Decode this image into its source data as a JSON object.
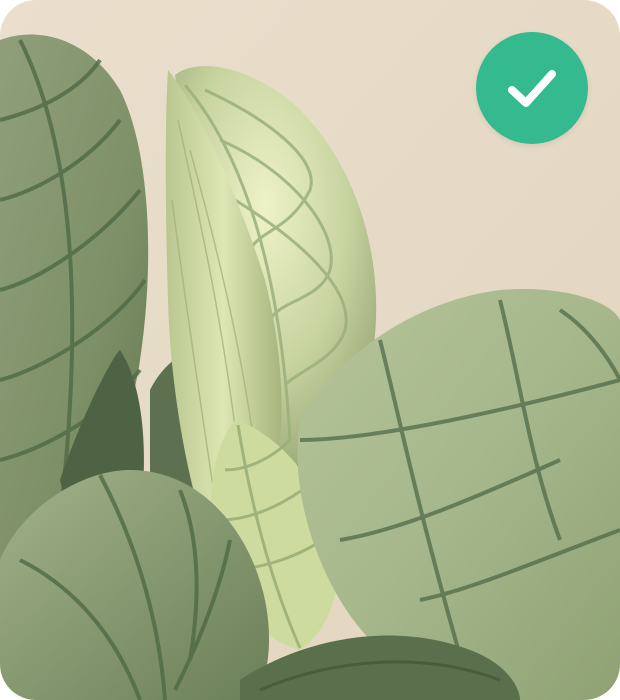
{
  "image": {
    "subject": "plant-leaves-photo"
  },
  "badge": {
    "icon": "checkmark-icon",
    "background_color": "#35b98f",
    "icon_color": "#ffffff"
  },
  "colors": {
    "background_wall": "#e7dcc7",
    "leaf_light": "#d7e2b8",
    "leaf_mid": "#a9bb8d",
    "leaf_dark": "#5f7551",
    "leaf_vein": "#4f6a47"
  }
}
